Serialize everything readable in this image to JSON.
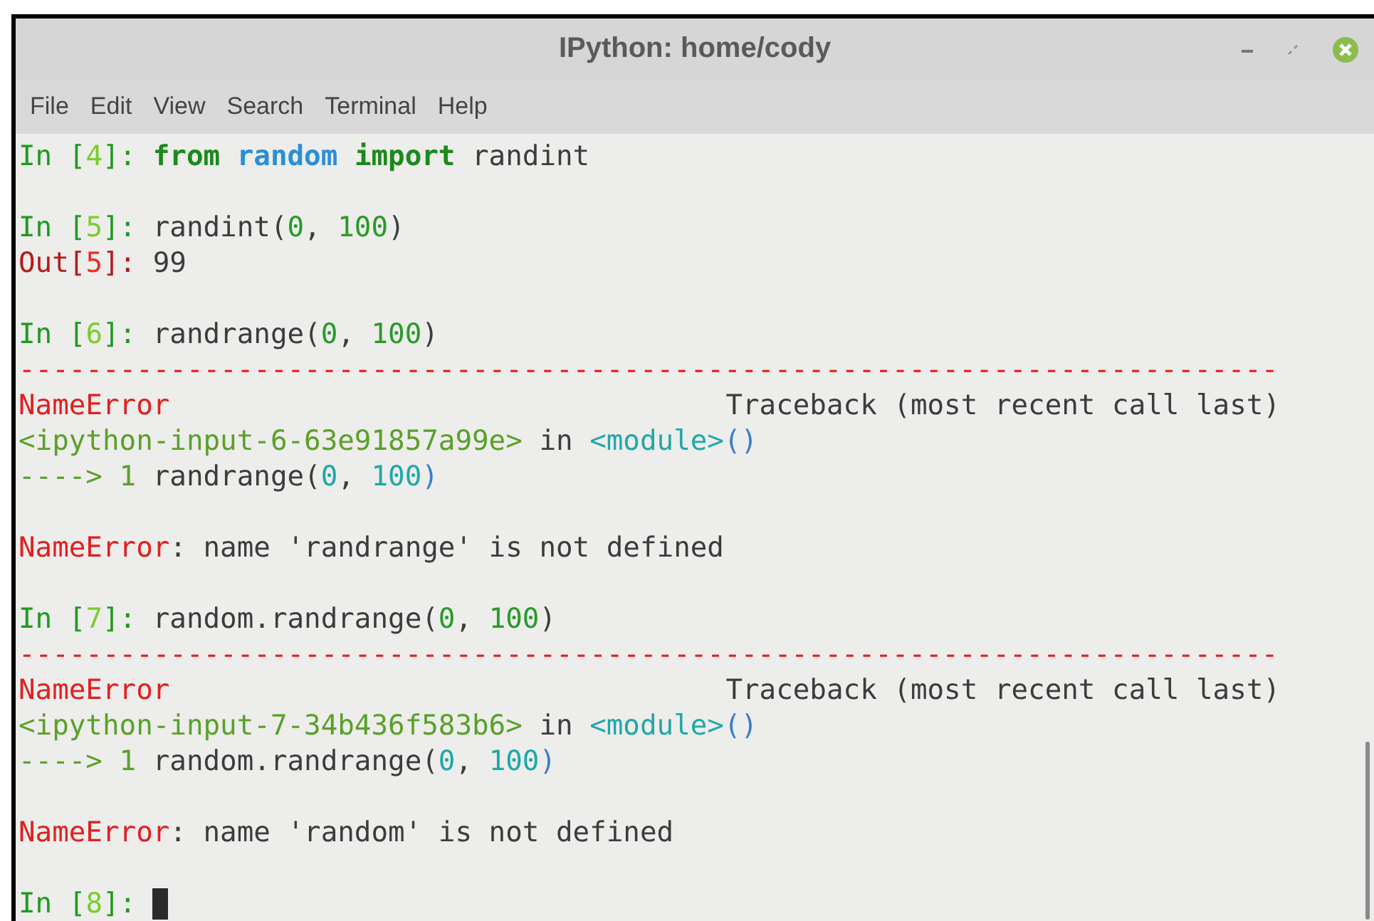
{
  "window": {
    "title": "IPython: home/cody"
  },
  "menu": [
    "File",
    "Edit",
    "View",
    "Search",
    "Terminal",
    "Help"
  ],
  "lines": [
    {
      "kind": "code",
      "segments": [
        {
          "kind": "prompt",
          "text": "In ["
        },
        {
          "kind": "num",
          "text": "4"
        },
        {
          "kind": "prompt",
          "text": "]: "
        },
        {
          "kind": "keyword",
          "text": "from "
        },
        {
          "kind": "module",
          "text": "random "
        },
        {
          "kind": "keyword",
          "text": "import "
        },
        {
          "kind": "plain",
          "text": "randint"
        }
      ]
    },
    {
      "kind": "blank"
    },
    {
      "kind": "code",
      "segments": [
        {
          "kind": "prompt",
          "text": "In ["
        },
        {
          "kind": "num",
          "text": "5"
        },
        {
          "kind": "prompt",
          "text": "]: "
        },
        {
          "kind": "plain",
          "text": "randint("
        },
        {
          "kind": "literal",
          "text": "0"
        },
        {
          "kind": "plain",
          "text": ", "
        },
        {
          "kind": "literal",
          "text": "100"
        },
        {
          "kind": "plain",
          "text": ")"
        }
      ]
    },
    {
      "kind": "code",
      "segments": [
        {
          "kind": "out",
          "text": "Out["
        },
        {
          "kind": "outnum",
          "text": "5"
        },
        {
          "kind": "out",
          "text": "]: "
        },
        {
          "kind": "plain",
          "text": "99"
        }
      ]
    },
    {
      "kind": "blank"
    },
    {
      "kind": "code",
      "segments": [
        {
          "kind": "prompt",
          "text": "In ["
        },
        {
          "kind": "num",
          "text": "6"
        },
        {
          "kind": "prompt",
          "text": "]: "
        },
        {
          "kind": "plain",
          "text": "randrange("
        },
        {
          "kind": "literal",
          "text": "0"
        },
        {
          "kind": "plain",
          "text": ", "
        },
        {
          "kind": "literal",
          "text": "100"
        },
        {
          "kind": "plain",
          "text": ")"
        }
      ]
    },
    {
      "kind": "rule",
      "text": "---------------------------------------------------------------------------"
    },
    {
      "kind": "header",
      "left": "NameError",
      "right": "Traceback (most recent call last)"
    },
    {
      "kind": "code",
      "segments": [
        {
          "kind": "file",
          "text": "<ipython-input-6-63e91857a99e>"
        },
        {
          "kind": "plain",
          "text": " in "
        },
        {
          "kind": "teal",
          "text": "<module>"
        },
        {
          "kind": "paren",
          "text": "()"
        }
      ]
    },
    {
      "kind": "code",
      "segments": [
        {
          "kind": "file",
          "text": "----> 1 "
        },
        {
          "kind": "plain",
          "text": "randrange("
        },
        {
          "kind": "teal",
          "text": "0"
        },
        {
          "kind": "plain",
          "text": ", "
        },
        {
          "kind": "teal",
          "text": "100"
        },
        {
          "kind": "paren",
          "text": ")"
        }
      ]
    },
    {
      "kind": "blank"
    },
    {
      "kind": "code",
      "segments": [
        {
          "kind": "error",
          "text": "NameError"
        },
        {
          "kind": "plain",
          "text": ": name 'randrange' is not defined"
        }
      ]
    },
    {
      "kind": "blank"
    },
    {
      "kind": "code",
      "segments": [
        {
          "kind": "prompt",
          "text": "In ["
        },
        {
          "kind": "num",
          "text": "7"
        },
        {
          "kind": "prompt",
          "text": "]: "
        },
        {
          "kind": "plain",
          "text": "random.randrange("
        },
        {
          "kind": "literal",
          "text": "0"
        },
        {
          "kind": "plain",
          "text": ", "
        },
        {
          "kind": "literal",
          "text": "100"
        },
        {
          "kind": "plain",
          "text": ")"
        }
      ]
    },
    {
      "kind": "rule",
      "text": "---------------------------------------------------------------------------"
    },
    {
      "kind": "header",
      "left": "NameError",
      "right": "Traceback (most recent call last)"
    },
    {
      "kind": "code",
      "segments": [
        {
          "kind": "file",
          "text": "<ipython-input-7-34b436f583b6>"
        },
        {
          "kind": "plain",
          "text": " in "
        },
        {
          "kind": "teal",
          "text": "<module>"
        },
        {
          "kind": "paren",
          "text": "()"
        }
      ]
    },
    {
      "kind": "code",
      "segments": [
        {
          "kind": "file",
          "text": "----> 1 "
        },
        {
          "kind": "plain",
          "text": "random.randrange("
        },
        {
          "kind": "teal",
          "text": "0"
        },
        {
          "kind": "plain",
          "text": ", "
        },
        {
          "kind": "teal",
          "text": "100"
        },
        {
          "kind": "paren",
          "text": ")"
        }
      ]
    },
    {
      "kind": "blank"
    },
    {
      "kind": "code",
      "segments": [
        {
          "kind": "error",
          "text": "NameError"
        },
        {
          "kind": "plain",
          "text": ": name 'random' is not defined"
        }
      ]
    },
    {
      "kind": "blank"
    },
    {
      "kind": "prompt_cursor",
      "segments": [
        {
          "kind": "prompt",
          "text": "In ["
        },
        {
          "kind": "num",
          "text": "8"
        },
        {
          "kind": "prompt",
          "text": "]: "
        }
      ]
    }
  ]
}
